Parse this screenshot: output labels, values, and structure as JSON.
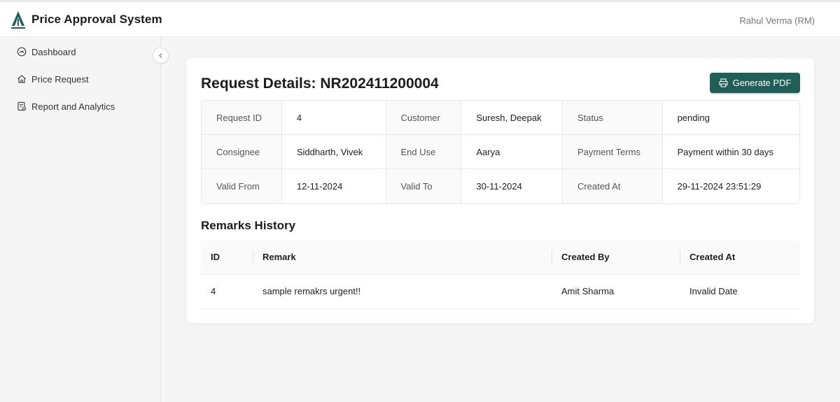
{
  "header": {
    "app_title": "Price Approval System",
    "user_name": "Rahul Verma (RM)",
    "logo_icon": "company-logo",
    "accent_color": "#1f5f58"
  },
  "sidebar": {
    "items": [
      {
        "label": "Dashboard",
        "icon": "dashboard-gauge-icon"
      },
      {
        "label": "Price Request",
        "icon": "home-icon"
      },
      {
        "label": "Report and Analytics",
        "icon": "report-icon"
      }
    ],
    "collapse_icon": "chevron-left-icon"
  },
  "main": {
    "title": "Request Details: NR202411200004",
    "generate_pdf_label": "Generate PDF",
    "details": [
      [
        {
          "label": "Request ID",
          "value": "4"
        },
        {
          "label": "Customer",
          "value": "Suresh, Deepak"
        },
        {
          "label": "Status",
          "value": "pending"
        }
      ],
      [
        {
          "label": "Consignee",
          "value": "Siddharth, Vivek"
        },
        {
          "label": "End Use",
          "value": "Aarya"
        },
        {
          "label": "Payment Terms",
          "value": "Payment within 30 days"
        }
      ],
      [
        {
          "label": "Valid From",
          "value": "12-11-2024"
        },
        {
          "label": "Valid To",
          "value": "30-11-2024"
        },
        {
          "label": "Created At",
          "value": "29-11-2024 23:51:29"
        }
      ]
    ],
    "remarks_title": "Remarks History",
    "remarks_columns": [
      "ID",
      "Remark",
      "Created By",
      "Created At"
    ],
    "remarks_rows": [
      [
        "4",
        "sample remakrs urgent!!",
        "Amit Sharma",
        "Invalid Date"
      ]
    ]
  }
}
